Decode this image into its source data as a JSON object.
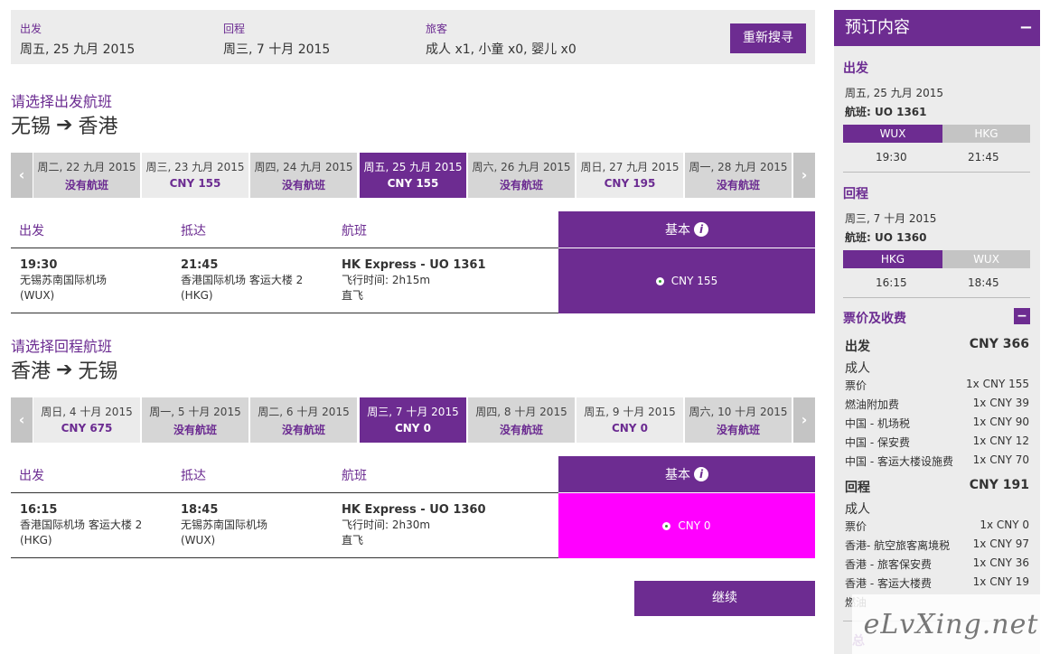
{
  "search": {
    "depart_label": "出发",
    "depart_value": "周五, 25 九月 2015",
    "return_label": "回程",
    "return_value": "周三, 7 十月 2015",
    "pax_label": "旅客",
    "pax_value": "成人 x1, 小童 x0, 婴儿 x0",
    "research_button": "重新搜寻"
  },
  "outbound": {
    "section_title": "请选择出发航班",
    "from": "无锡",
    "to": "香港",
    "dates": [
      {
        "day": "周二, 22 九月 2015",
        "price": "没有航班",
        "state": "none"
      },
      {
        "day": "周三, 23 九月 2015",
        "price": "CNY 155",
        "state": "avail"
      },
      {
        "day": "周四, 24 九月 2015",
        "price": "没有航班",
        "state": "none"
      },
      {
        "day": "周五, 25 九月 2015",
        "price": "CNY 155",
        "state": "sel"
      },
      {
        "day": "周六, 26 九月 2015",
        "price": "没有航班",
        "state": "none"
      },
      {
        "day": "周日, 27 九月 2015",
        "price": "CNY 195",
        "state": "avail"
      },
      {
        "day": "周一, 28 九月 2015",
        "price": "没有航班",
        "state": "none"
      }
    ],
    "headers": {
      "depart": "出发",
      "arrive": "抵达",
      "flight": "航班",
      "fare": "基本"
    },
    "flight": {
      "dep_time": "19:30",
      "dep_airport": "无锡苏南国际机场",
      "dep_code": "(WUX)",
      "arr_time": "21:45",
      "arr_airport": "香港国际机场 客运大楼 2",
      "arr_code": "(HKG)",
      "name": "HK Express - UO 1361",
      "duration": "飞行时间: 2h15m",
      "stops": "直飞",
      "fare": "CNY 155"
    }
  },
  "inbound": {
    "section_title": "请选择回程航班",
    "from": "香港",
    "to": "无锡",
    "dates": [
      {
        "day": "周日, 4 十月 2015",
        "price": "CNY 675",
        "state": "avail"
      },
      {
        "day": "周一, 5 十月 2015",
        "price": "没有航班",
        "state": "none"
      },
      {
        "day": "周二, 6 十月 2015",
        "price": "没有航班",
        "state": "none"
      },
      {
        "day": "周三, 7 十月 2015",
        "price": "CNY 0",
        "state": "sel"
      },
      {
        "day": "周四, 8 十月 2015",
        "price": "没有航班",
        "state": "none"
      },
      {
        "day": "周五, 9 十月 2015",
        "price": "CNY 0",
        "state": "avail"
      },
      {
        "day": "周六, 10 十月 2015",
        "price": "没有航班",
        "state": "none"
      }
    ],
    "headers": {
      "depart": "出发",
      "arrive": "抵达",
      "flight": "航班",
      "fare": "基本"
    },
    "flight": {
      "dep_time": "16:15",
      "dep_airport": "香港国际机场 客运大楼 2",
      "dep_code": "(HKG)",
      "arr_time": "18:45",
      "arr_airport": "无锡苏南国际机场",
      "arr_code": "(WUX)",
      "name": "HK Express - UO 1360",
      "duration": "飞行时间: 2h30m",
      "stops": "直飞",
      "fare": "CNY 0"
    }
  },
  "continue_button": "继续",
  "sidebar": {
    "title": "预订内容",
    "collapse": "−",
    "depart": {
      "label": "出发",
      "date": "周五, 25 九月 2015",
      "flight": "航班: UO 1361",
      "from": "WUX",
      "to": "HKG",
      "dep_time": "19:30",
      "arr_time": "21:45"
    },
    "return": {
      "label": "回程",
      "date": "周三, 7 十月 2015",
      "flight": "航班: UO 1360",
      "from": "HKG",
      "to": "WUX",
      "dep_time": "16:15",
      "arr_time": "18:45"
    },
    "fees_title": "票价及收费",
    "fees_collapse": "−",
    "out_fees": {
      "label": "出发",
      "total": "CNY 366",
      "pax": "成人",
      "items": [
        {
          "name": "票价",
          "amount": "1x CNY 155"
        },
        {
          "name": "燃油附加费",
          "amount": "1x CNY 39"
        },
        {
          "name": "中国 - 机场税",
          "amount": "1x CNY 90"
        },
        {
          "name": "中国 - 保安费",
          "amount": "1x CNY 12"
        },
        {
          "name": "中国 - 客运大楼设施费",
          "amount": "1x CNY 70"
        }
      ]
    },
    "ret_fees": {
      "label": "回程",
      "total": "CNY 191",
      "pax": "成人",
      "items": [
        {
          "name": "票价",
          "amount": "1x CNY 0"
        },
        {
          "name": "香港- 航空旅客离境税",
          "amount": "1x CNY 97"
        },
        {
          "name": "香港 - 旅客保安费",
          "amount": "1x CNY 36"
        },
        {
          "name": "香港 - 客运大楼费",
          "amount": "1x CNY 19"
        },
        {
          "name": "燃油",
          "amount": ""
        }
      ]
    },
    "total_label": "总"
  },
  "watermark": "eLvXing.net",
  "colors": {
    "brand_purple": "#6d2c91",
    "selected_fare_magenta": "#ff00ff",
    "panel_grey": "#ececec"
  }
}
